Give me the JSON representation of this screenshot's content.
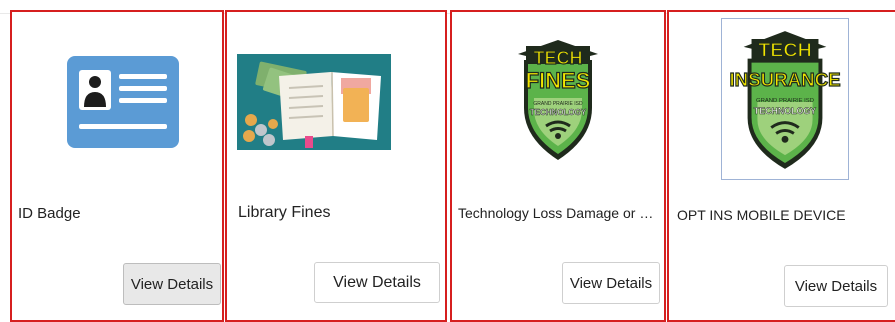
{
  "products": [
    {
      "title": "ID Badge",
      "button_label": "View Details",
      "image": "id-badge-icon",
      "button_state": "hover"
    },
    {
      "title": "Library Fines",
      "button_label": "View Details",
      "image": "library-fines-illustration"
    },
    {
      "title": "Technology Loss Damage or Rep...",
      "button_label": "View Details",
      "image": "tech-fines-badge",
      "image_text": [
        "TECH",
        "FINES",
        "GRAND PRAIRIE ISD",
        "TECHNOLOGY"
      ]
    },
    {
      "title": "OPT INS MOBILE DEVICE",
      "button_label": "View Details",
      "image": "tech-insurance-badge",
      "image_text": [
        "TECH",
        "INSURANCE",
        "GRAND PRAIRIE ISD",
        "TECHNOLOGY"
      ]
    }
  ],
  "colors": {
    "card_border": "#d61f1f",
    "id_badge_blue": "#5b9bd5",
    "shield_green": "#5cb34a",
    "tech_yellow": "#f2e600",
    "library_teal": "#217e86"
  }
}
